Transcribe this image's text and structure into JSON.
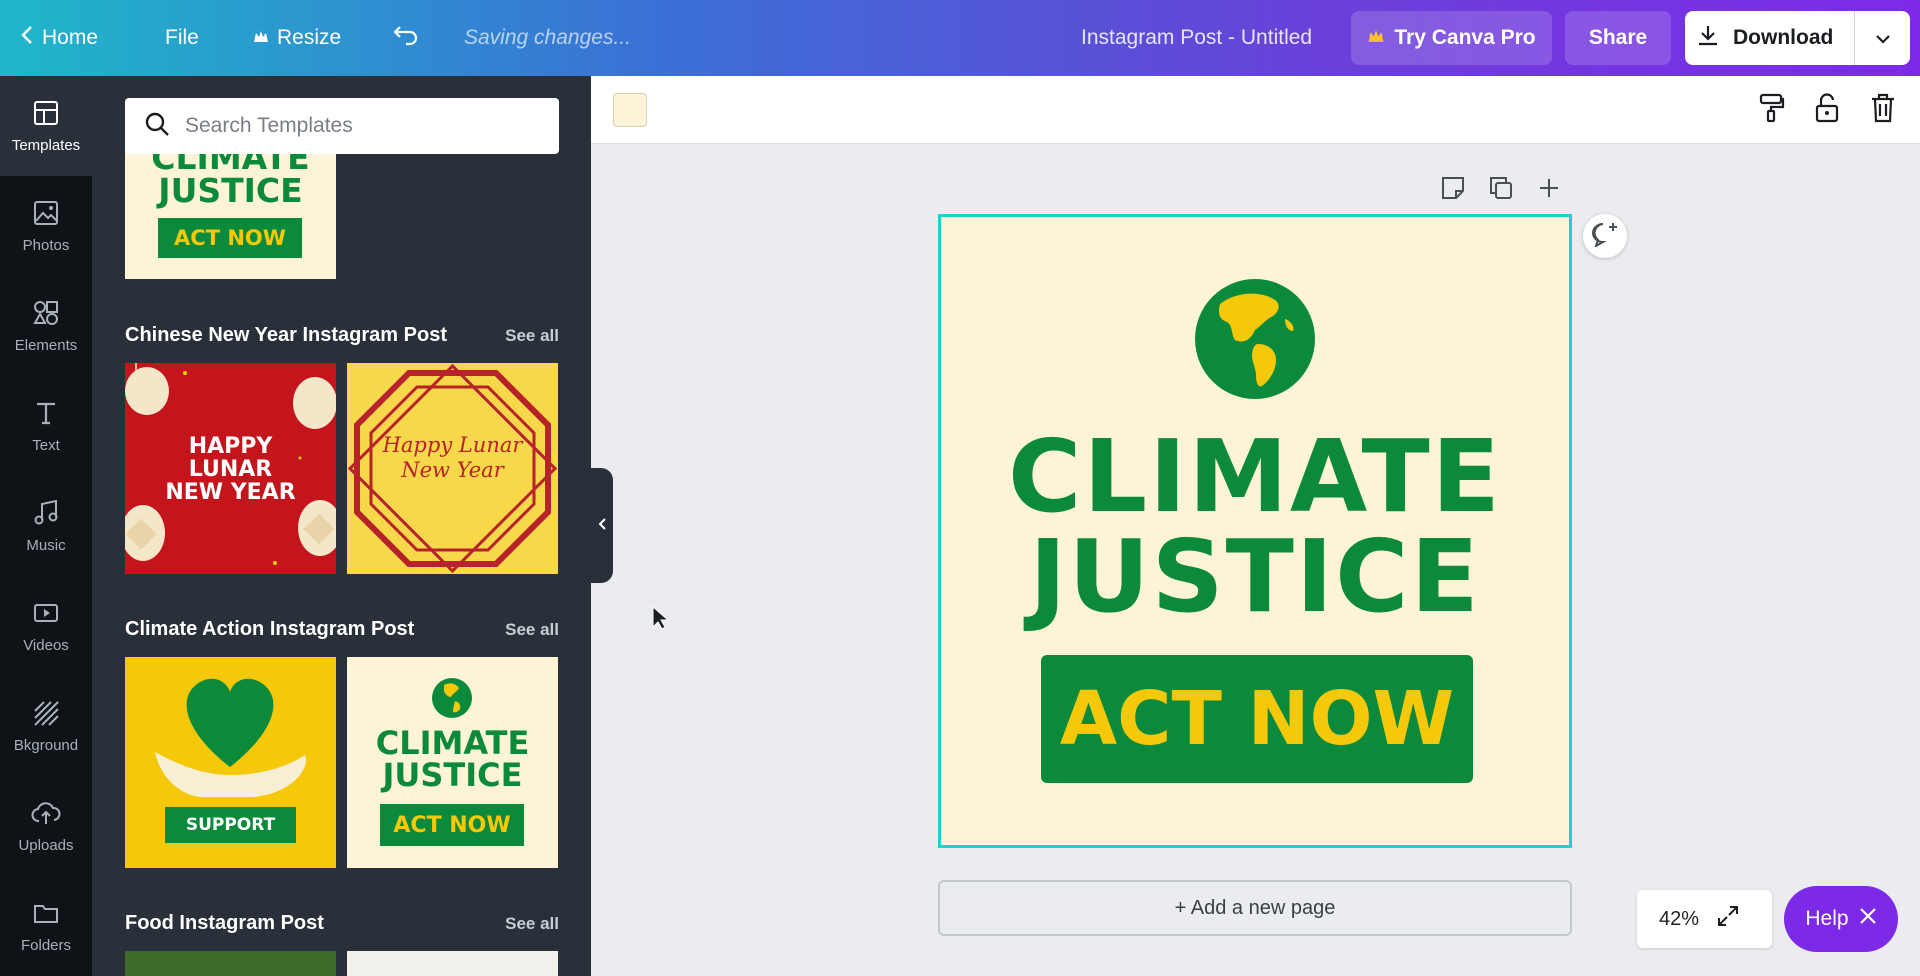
{
  "topbar": {
    "home_label": "Home",
    "file_label": "File",
    "resize_label": "Resize",
    "saving_text": "Saving changes...",
    "doc_title": "Instagram Post - Untitled",
    "try_pro_label": "Try Canva Pro",
    "share_label": "Share",
    "download_label": "Download"
  },
  "rail": {
    "items": [
      {
        "label": "Templates",
        "icon": "templates-icon"
      },
      {
        "label": "Photos",
        "icon": "photos-icon"
      },
      {
        "label": "Elements",
        "icon": "elements-icon"
      },
      {
        "label": "Text",
        "icon": "text-icon"
      },
      {
        "label": "Music",
        "icon": "music-icon"
      },
      {
        "label": "Videos",
        "icon": "videos-icon"
      },
      {
        "label": "Bkground",
        "icon": "background-icon"
      },
      {
        "label": "Uploads",
        "icon": "uploads-icon"
      },
      {
        "label": "Folders",
        "icon": "folders-icon"
      }
    ]
  },
  "panel": {
    "search_placeholder": "Search Templates",
    "sections": [
      {
        "title": "Chinese New Year Instagram Post",
        "see_all": "See all"
      },
      {
        "title": "Climate Action Instagram Post",
        "see_all": "See all"
      },
      {
        "title": "Food Instagram Post",
        "see_all": "See all"
      }
    ],
    "thumbs": {
      "top_line1": "CLIMATE",
      "top_line2": "JUSTICE",
      "top_button": "ACT NOW",
      "cny1_line1": "HAPPY",
      "cny1_line2": "LUNAR",
      "cny1_line3": "NEW YEAR",
      "cny2_line1": "Happy Lunar",
      "cny2_line2": "New Year",
      "climate1_button": "SUPPORT",
      "climate2_line1": "CLIMATE",
      "climate2_line2": "JUSTICE",
      "climate2_button": "ACT NOW"
    }
  },
  "canvas": {
    "line1": "CLIMATE",
    "line2": "JUSTICE",
    "button": "ACT NOW",
    "bg_color": "#fdf4d7",
    "green": "#0b8a3c",
    "yellow": "#f5c80a"
  },
  "add_page_label": "+ Add a new page",
  "zoom_level": "42%",
  "help_label": "Help",
  "colors": {
    "accent": "#7d2ae8",
    "selection": "#1fd0d3"
  }
}
